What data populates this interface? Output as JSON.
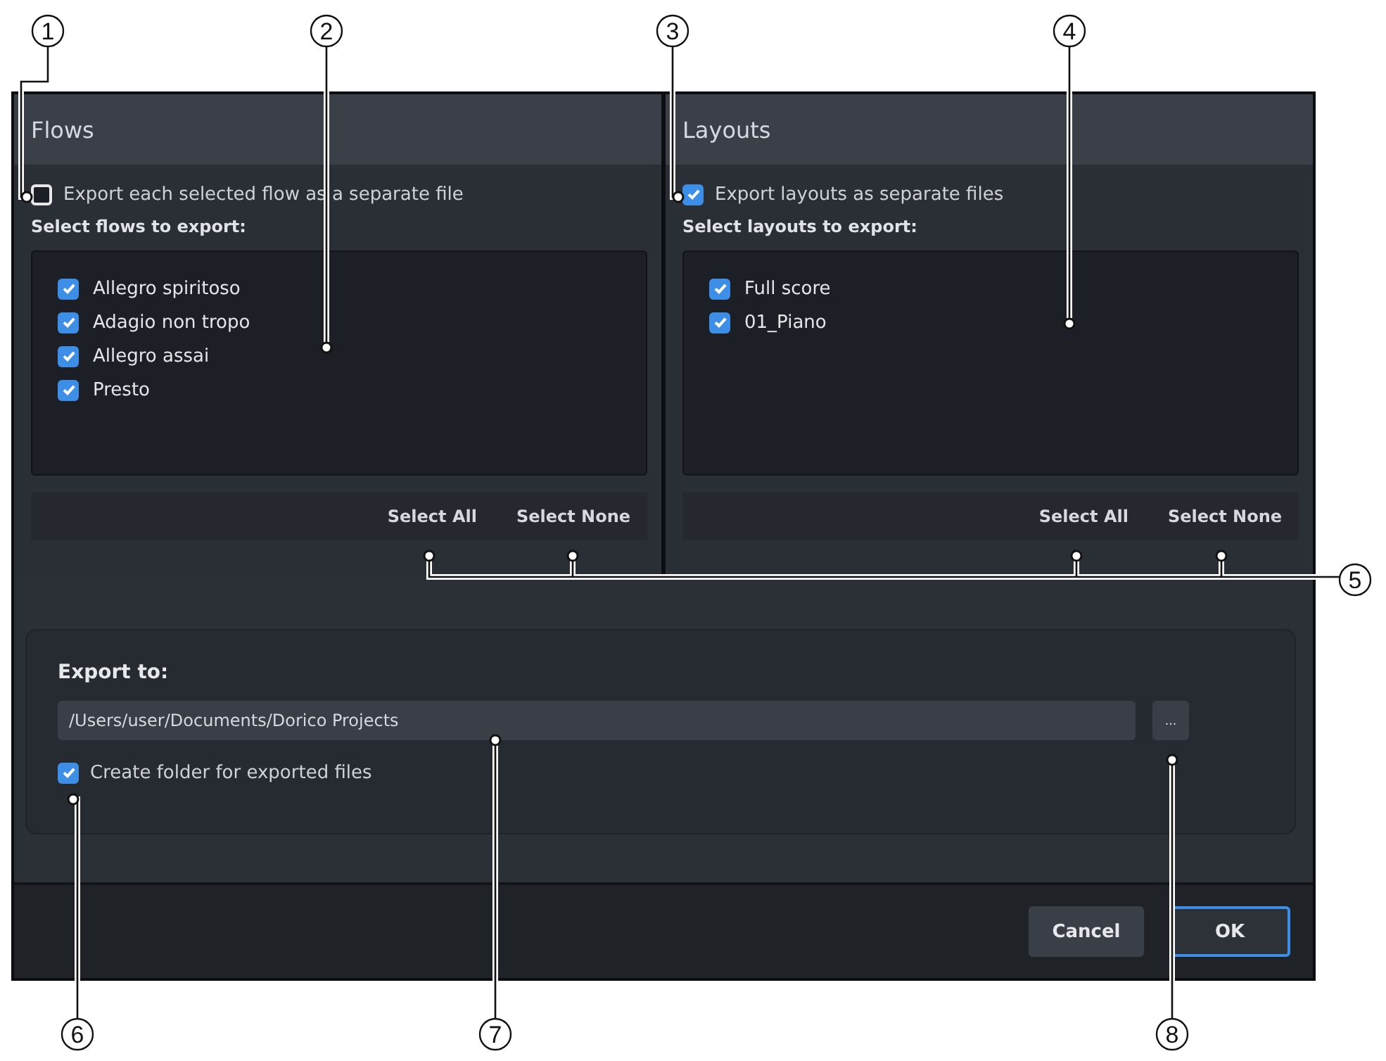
{
  "flows": {
    "title": "Flows",
    "separate": {
      "label": "Export each selected flow as a separate file",
      "checked": false
    },
    "list_label": "Select flows to export:",
    "items": [
      {
        "label": "Allegro spiritoso",
        "checked": true
      },
      {
        "label": "Adagio non tropo",
        "checked": true
      },
      {
        "label": "Allegro assai",
        "checked": true
      },
      {
        "label": "Presto",
        "checked": true
      }
    ],
    "actions": [
      "Select All",
      "Select None"
    ]
  },
  "layouts": {
    "title": "Layouts",
    "separate": {
      "label": "Export layouts as separate files",
      "checked": true
    },
    "list_label": "Select layouts to export:",
    "items": [
      {
        "label": "Full score",
        "checked": true
      },
      {
        "label": "01_Piano",
        "checked": true
      }
    ],
    "actions": [
      "Select All",
      "Select None"
    ]
  },
  "export": {
    "label": "Export to:",
    "path": "/Users/user/Documents/Dorico Projects",
    "browse": "...",
    "create_folder": {
      "label": "Create folder for exported files",
      "checked": true
    }
  },
  "buttons": [
    {
      "label": "Cancel",
      "kind": "secondary"
    },
    {
      "label": "OK",
      "kind": "primary"
    }
  ],
  "callouts": [
    "1",
    "2",
    "3",
    "4",
    "5",
    "6",
    "7",
    "8"
  ]
}
